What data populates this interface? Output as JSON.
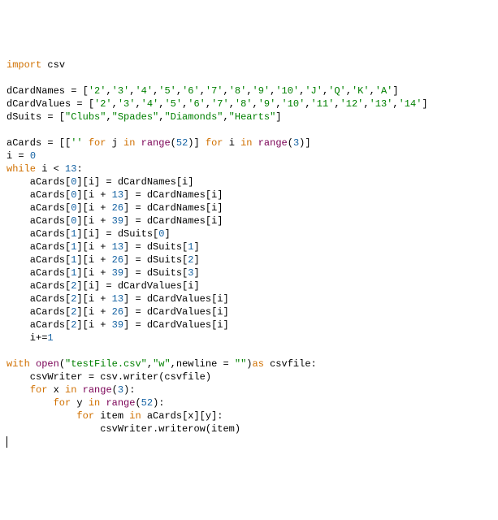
{
  "code": {
    "l1a": "import",
    "l1b": " csv",
    "blank1": "",
    "l2a": "dCardNames = [",
    "l2b": "'2'",
    "l2c": ",",
    "l2d": "'3'",
    "l2e": ",",
    "l2f": "'4'",
    "l2g": ",",
    "l2h": "'5'",
    "l2i": ",",
    "l2j": "'6'",
    "l2k": ",",
    "l2l": "'7'",
    "l2m": ",",
    "l2n": "'8'",
    "l2o": ",",
    "l2p": "'9'",
    "l2q": ",",
    "l2r": "'10'",
    "l2s": ",",
    "l2t": "'J'",
    "l2u": ",",
    "l2v": "'Q'",
    "l2w": ",",
    "l2x": "'K'",
    "l2y": ",",
    "l2z": "'A'",
    "l2end": "]",
    "l3a": "dCardValues = [",
    "l3b": "'2'",
    "l3c": ",",
    "l3d": "'3'",
    "l3e": ",",
    "l3f": "'4'",
    "l3g": ",",
    "l3h": "'5'",
    "l3i": ",",
    "l3j": "'6'",
    "l3k": ",",
    "l3l": "'7'",
    "l3m": ",",
    "l3n": "'8'",
    "l3o": ",",
    "l3p": "'9'",
    "l3q": ",",
    "l3r": "'10'",
    "l3s": ",",
    "l3t": "'11'",
    "l3u": ",",
    "l3v": "'12'",
    "l3w": ",",
    "l3x": "'13'",
    "l3y": ",",
    "l3z": "'14'",
    "l3end": "]",
    "l4a": "dSuits = [",
    "l4b": "\"Clubs\"",
    "l4c": ",",
    "l4d": "\"Spades\"",
    "l4e": ",",
    "l4f": "\"Diamonds\"",
    "l4g": ",",
    "l4h": "\"Hearts\"",
    "l4end": "]",
    "blank2": "",
    "l5a": "aCards = [[",
    "l5b": "''",
    "l5c": " ",
    "l5d": "for",
    "l5e": " j ",
    "l5f": "in",
    "l5g": " ",
    "l5h": "range",
    "l5i": "(",
    "l5j": "52",
    "l5k": ")] ",
    "l5l": "for",
    "l5m": " i ",
    "l5n": "in",
    "l5o": " ",
    "l5p": "range",
    "l5q": "(",
    "l5r": "3",
    "l5s": ")]",
    "l6a": "i = ",
    "l6b": "0",
    "l7a": "while",
    "l7b": " i < ",
    "l7c": "13",
    "l7d": ":",
    "l8": "    aCards[",
    "l8b": "0",
    "l8c": "][i] = dCardNames[i]",
    "l9": "    aCards[",
    "l9b": "0",
    "l9c": "][i + ",
    "l9d": "13",
    "l9e": "] = dCardNames[i]",
    "l10": "    aCards[",
    "l10b": "0",
    "l10c": "][i + ",
    "l10d": "26",
    "l10e": "] = dCardNames[i]",
    "l11": "    aCards[",
    "l11b": "0",
    "l11c": "][i + ",
    "l11d": "39",
    "l11e": "] = dCardNames[i]",
    "l12": "    aCards[",
    "l12b": "1",
    "l12c": "][i] = dSuits[",
    "l12d": "0",
    "l12e": "]",
    "l13": "    aCards[",
    "l13b": "1",
    "l13c": "][i + ",
    "l13d": "13",
    "l13e": "] = dSuits[",
    "l13f": "1",
    "l13g": "]",
    "l14": "    aCards[",
    "l14b": "1",
    "l14c": "][i + ",
    "l14d": "26",
    "l14e": "] = dSuits[",
    "l14f": "2",
    "l14g": "]",
    "l15": "    aCards[",
    "l15b": "1",
    "l15c": "][i + ",
    "l15d": "39",
    "l15e": "] = dSuits[",
    "l15f": "3",
    "l15g": "]",
    "l16": "    aCards[",
    "l16b": "2",
    "l16c": "][i] = dCardValues[i]",
    "l17": "    aCards[",
    "l17b": "2",
    "l17c": "][i + ",
    "l17d": "13",
    "l17e": "] = dCardValues[i]",
    "l18": "    aCards[",
    "l18b": "2",
    "l18c": "][i + ",
    "l18d": "26",
    "l18e": "] = dCardValues[i]",
    "l19": "    aCards[",
    "l19b": "2",
    "l19c": "][i + ",
    "l19d": "39",
    "l19e": "] = dCardValues[i]",
    "l20": "    i+=",
    "l20b": "1",
    "blank3": "",
    "l21a": "with",
    "l21b": " ",
    "l21c": "open",
    "l21d": "(",
    "l21e": "\"testFile.csv\"",
    "l21f": ",",
    "l21g": "\"w\"",
    "l21h": ",newline = ",
    "l21i": "\"\"",
    "l21j": ")",
    "l21k": "as",
    "l21l": " csvfile:",
    "l22": "    csvWriter = csv.writer(csvfile)",
    "l23a": "    ",
    "l23b": "for",
    "l23c": " x ",
    "l23d": "in",
    "l23e": " ",
    "l23f": "range",
    "l23g": "(",
    "l23h": "3",
    "l23i": "):",
    "l24a": "        ",
    "l24b": "for",
    "l24c": " y ",
    "l24d": "in",
    "l24e": " ",
    "l24f": "range",
    "l24g": "(",
    "l24h": "52",
    "l24i": "):",
    "l25a": "            ",
    "l25b": "for",
    "l25c": " item ",
    "l25d": "in",
    "l25e": " aCards[x][y]:",
    "l26": "                csvWriter.writerow(item)"
  }
}
